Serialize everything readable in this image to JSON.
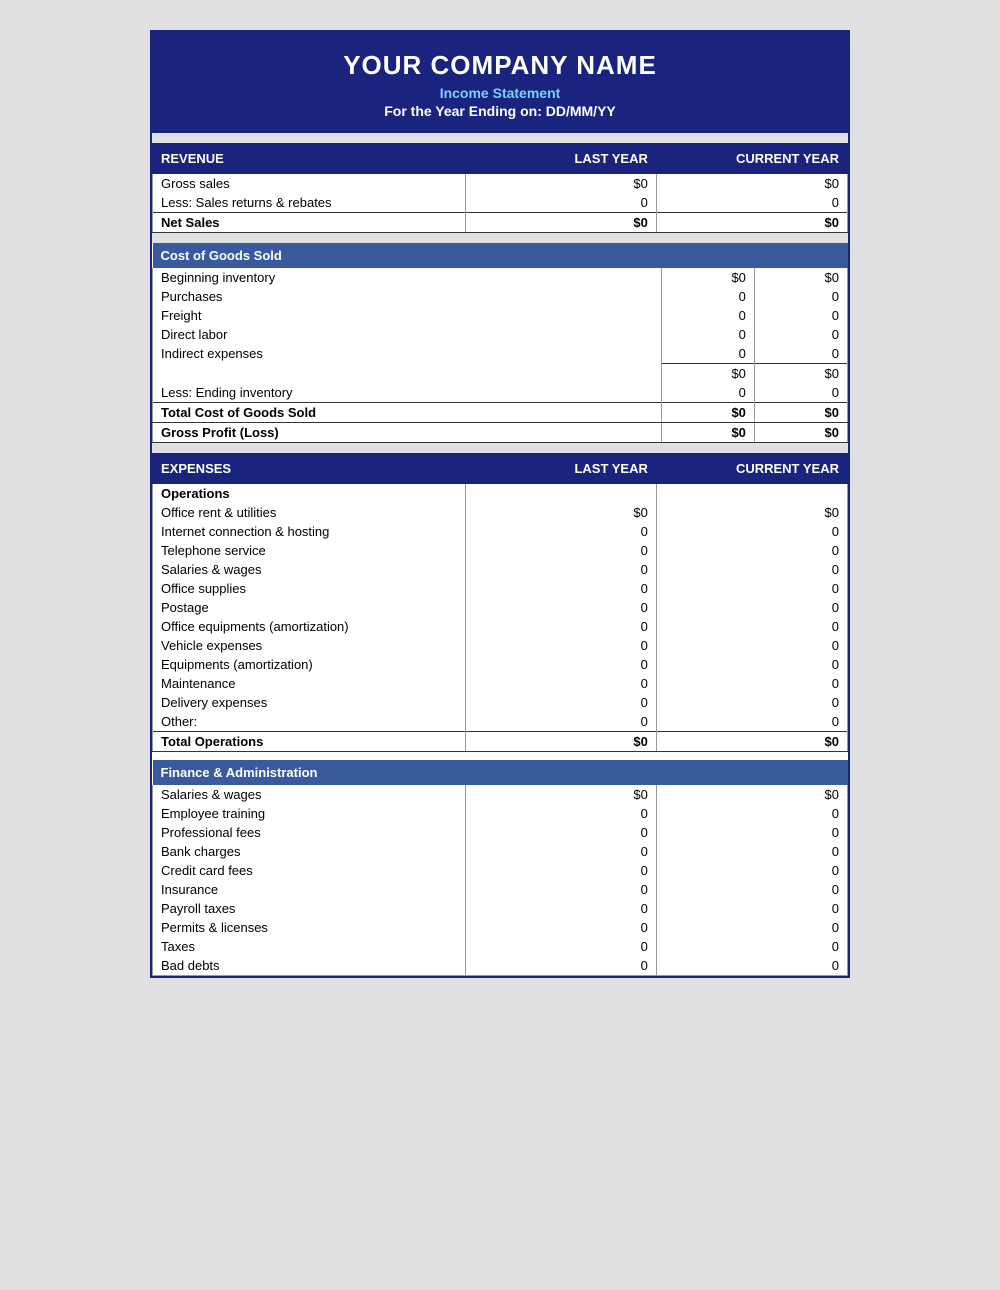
{
  "header": {
    "company_name": "YOUR COMPANY NAME",
    "subtitle": "Income Statement",
    "period": "For the Year Ending on: DD/MM/YY"
  },
  "revenue_section": {
    "label": "REVENUE",
    "col1": "LAST YEAR",
    "col2": "CURRENT YEAR",
    "rows": [
      {
        "label": "Gross sales",
        "last": "$0",
        "current": "$0"
      },
      {
        "label": "Less: Sales returns & rebates",
        "last": "0",
        "current": "0"
      },
      {
        "label": "Net Sales",
        "last": "$0",
        "current": "$0",
        "type": "total"
      }
    ]
  },
  "cogs_section": {
    "label": "Cost of Goods Sold",
    "rows": [
      {
        "label": "Beginning inventory",
        "last": "$0",
        "current": "$0"
      },
      {
        "label": "Purchases",
        "last": "0",
        "current": "0"
      },
      {
        "label": "Freight",
        "last": "0",
        "current": "0"
      },
      {
        "label": "Direct labor",
        "last": "0",
        "current": "0"
      },
      {
        "label": "Indirect expenses",
        "last": "0",
        "current": "0"
      },
      {
        "label": "",
        "last": "$0",
        "current": "$0",
        "type": "subtotal"
      },
      {
        "label": "Less: Ending inventory",
        "last": "0",
        "current": "0"
      },
      {
        "label": "Total Cost of Goods Sold",
        "last": "$0",
        "current": "$0",
        "type": "total"
      },
      {
        "label": "Gross Profit (Loss)",
        "last": "$0",
        "current": "$0",
        "type": "total"
      }
    ]
  },
  "expenses_section": {
    "label": "EXPENSES",
    "col1": "LAST YEAR",
    "col2": "CURRENT YEAR",
    "operations": {
      "label": "Operations",
      "rows": [
        {
          "label": "Office rent & utilities",
          "last": "$0",
          "current": "$0"
        },
        {
          "label": "Internet connection & hosting",
          "last": "0",
          "current": "0"
        },
        {
          "label": "Telephone service",
          "last": "0",
          "current": "0"
        },
        {
          "label": "Salaries & wages",
          "last": "0",
          "current": "0"
        },
        {
          "label": "Office supplies",
          "last": "0",
          "current": "0"
        },
        {
          "label": "Postage",
          "last": "0",
          "current": "0"
        },
        {
          "label": "Office equipments (amortization)",
          "last": "0",
          "current": "0"
        },
        {
          "label": "Vehicle expenses",
          "last": "0",
          "current": "0"
        },
        {
          "label": "Equipments (amortization)",
          "last": "0",
          "current": "0"
        },
        {
          "label": "Maintenance",
          "last": "0",
          "current": "0"
        },
        {
          "label": "Delivery expenses",
          "last": "0",
          "current": "0"
        },
        {
          "label": "Other:",
          "last": "0",
          "current": "0"
        },
        {
          "label": "Total Operations",
          "last": "$0",
          "current": "$0",
          "type": "total"
        }
      ]
    },
    "finance": {
      "label": "Finance & Administration",
      "rows": [
        {
          "label": "Salaries & wages",
          "last": "$0",
          "current": "$0"
        },
        {
          "label": "Employee training",
          "last": "0",
          "current": "0"
        },
        {
          "label": "Professional fees",
          "last": "0",
          "current": "0"
        },
        {
          "label": "Bank charges",
          "last": "0",
          "current": "0"
        },
        {
          "label": "Credit card fees",
          "last": "0",
          "current": "0"
        },
        {
          "label": "Insurance",
          "last": "0",
          "current": "0"
        },
        {
          "label": "Payroll taxes",
          "last": "0",
          "current": "0"
        },
        {
          "label": "Permits & licenses",
          "last": "0",
          "current": "0"
        },
        {
          "label": "Taxes",
          "last": "0",
          "current": "0"
        },
        {
          "label": "Bad debts",
          "last": "0",
          "current": "0"
        }
      ]
    }
  }
}
